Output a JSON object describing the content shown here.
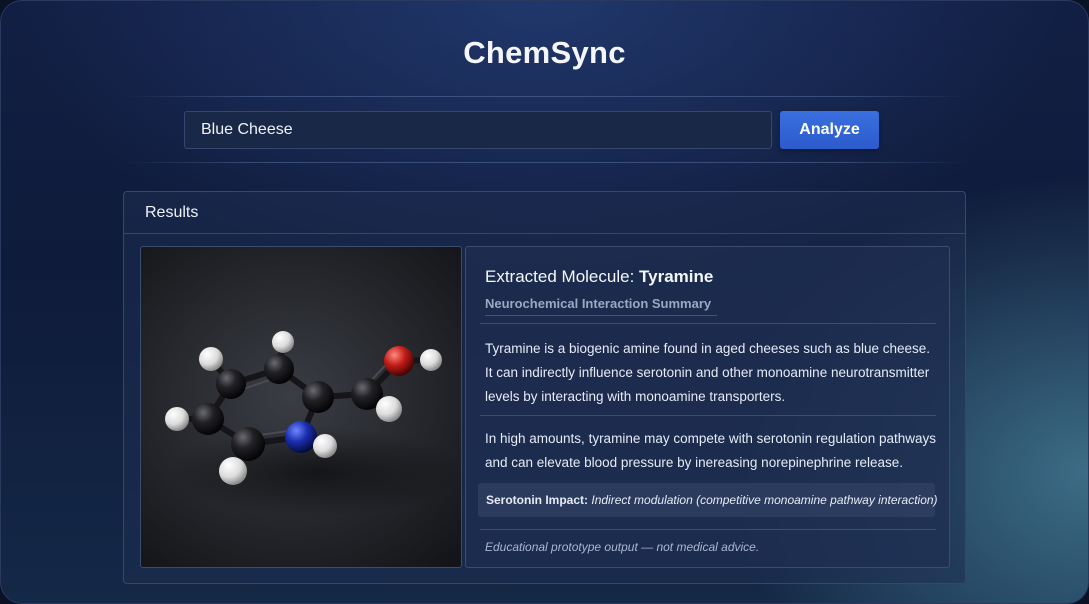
{
  "app": {
    "title": "ChemSync"
  },
  "search": {
    "value": "Blue Cheese",
    "button_label": "Analyze"
  },
  "results": {
    "header": "Results",
    "molecule": {
      "title_prefix": "Extracted Molecule: ",
      "name": "Tyramine",
      "subtitle": "Neurochemical Interaction Summary"
    },
    "paragraph1": [
      "Tyramine is a biogenic amine found in aged cheeses such as blue cheese.",
      "It can indirectly influence serotonin and other monoamine neurotransmitter",
      "levels by interacting with monoamine transporters."
    ],
    "paragraph2": [
      "In high amounts, tyramine may compete with serotonin regulation pathways",
      "and can elevate blood pressure by inereasing norepinephrine release."
    ],
    "impact": {
      "label": "Serotonin Impact:",
      "value": "Indirect modulation (competitive monoamine pathway interaction)"
    },
    "disclaimer": "Educational prototype output — not medical advice."
  },
  "colors": {
    "accent": "#2f62d6",
    "carbon": "#1b1b1f",
    "nitrogen": "#1530a8",
    "oxygen": "#c0201c",
    "hydrogen": "#f2f2f2"
  }
}
